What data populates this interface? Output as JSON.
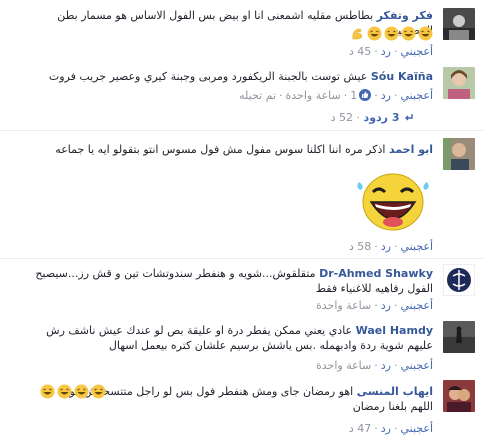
{
  "comments": [
    {
      "name": "فكر وتفكر",
      "text": "بطاطس مقليه اشمعنى انا او بيض بس الفول الاساس هو مسمار بطن المصريين",
      "actions": {
        "like": "أعجبني",
        "reply": "رد",
        "time": "45 د"
      }
    },
    {
      "name": "Sóu Kaïña",
      "text": "عيش توست بالجبنة الريكفورد ومربى وجبنة كيري وعصير جريب فروت",
      "actions": {
        "like": "أعجبني",
        "reply": "رد",
        "reactions": "1",
        "time": "ساعة واحدة",
        "edited": "تم تحيله"
      },
      "replies": "3 ردود",
      "reply_time": "52 د"
    },
    {
      "name": "ابو احمد",
      "text": "اذكر مره اننا اكلنا سوس مفول مش فول مسوس انتو بتقولو ايه يا جماعه",
      "actions": {
        "like": "أعجبني",
        "reply": "رد",
        "time": "58 د"
      }
    },
    {
      "name": "Dr-Ahmed Shawky",
      "text": "متقلقوش...شويه و هنفطر سندوتشات تين و قش رز...سيصبح الفول رفاهيه للاغنياء فقط",
      "actions": {
        "like": "أعجبني",
        "reply": "رد",
        "time": "ساعة واحدة"
      }
    },
    {
      "name": "Wael Hamdy",
      "text": "عادي يعني ممكن يفطر درة او عليقة بص لو عندك عيش ناشف رش عليهم شوية ردة وادبهمله .بس ياشش برسيم علشان كتره بيعمل اسهال",
      "actions": {
        "like": "أعجبني",
        "reply": "رد",
        "time": "ساعة واحدة"
      }
    },
    {
      "name": "ايهاب المنسى",
      "text": "اهو رمضان جاى ومش هنفطر فول بس لو راجل متتسحرش فول اللهم بلغنا رمضان",
      "actions": {
        "like": "أعجبني",
        "reply": "رد",
        "time": "47 د"
      }
    }
  ],
  "colors": {
    "name": "#365899",
    "link": "#4267b2",
    "meta": "#90949c",
    "emoji": "#f7c744"
  },
  "icons": [
    "laughing-emoji",
    "flexed-biceps-emoji",
    "like-reaction-icon",
    "reply-arrow-icon",
    "sticker-laughing-face"
  ]
}
